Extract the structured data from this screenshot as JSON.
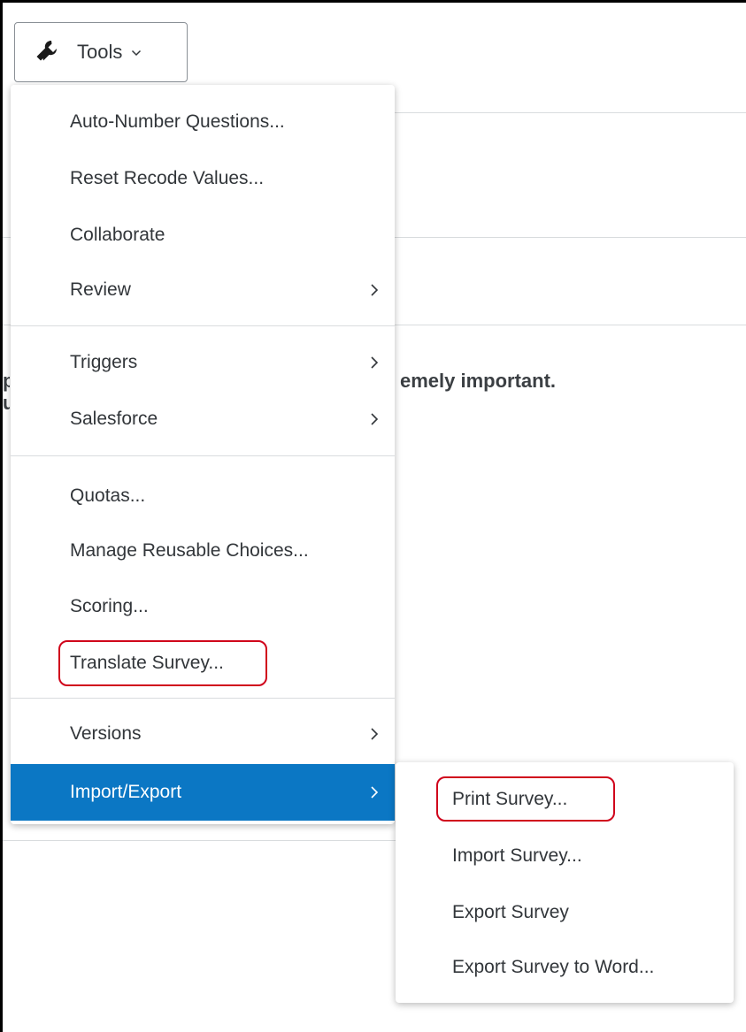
{
  "toolbar": {
    "tools_label": "Tools",
    "icon": "wrench-icon"
  },
  "page": {
    "partial_text": "emely important."
  },
  "menu": {
    "items": [
      {
        "label": "Auto-Number Questions...",
        "has_submenu": false
      },
      {
        "label": "Reset Recode Values...",
        "has_submenu": false
      },
      {
        "label": "Collaborate",
        "has_submenu": false
      },
      {
        "label": "Review",
        "has_submenu": true
      },
      {
        "label": "Triggers",
        "has_submenu": true
      },
      {
        "label": "Salesforce",
        "has_submenu": true
      },
      {
        "label": "Quotas...",
        "has_submenu": false
      },
      {
        "label": "Manage Reusable Choices...",
        "has_submenu": false
      },
      {
        "label": "Scoring...",
        "has_submenu": false
      },
      {
        "label": "Translate Survey...",
        "has_submenu": false,
        "highlighted": true
      },
      {
        "label": "Versions",
        "has_submenu": true
      },
      {
        "label": "Import/Export",
        "has_submenu": true,
        "active": true
      }
    ]
  },
  "submenu": {
    "parent": "Import/Export",
    "items": [
      {
        "label": "Print Survey...",
        "highlighted": true
      },
      {
        "label": "Import Survey..."
      },
      {
        "label": "Export Survey"
      },
      {
        "label": "Export Survey to Word..."
      }
    ]
  },
  "colors": {
    "active_bg": "#0b77c4",
    "highlight_border": "#d0021b",
    "text": "#32363a",
    "divider": "#d9dcde"
  }
}
